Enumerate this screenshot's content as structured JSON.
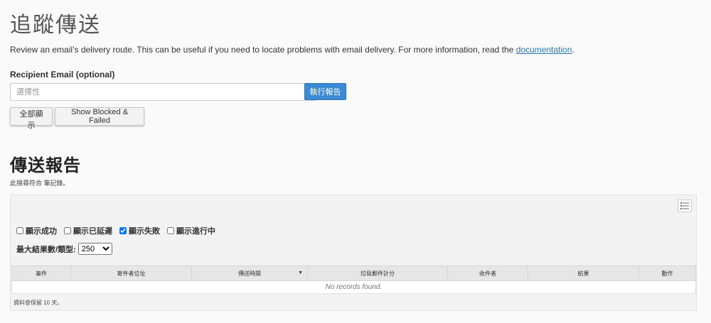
{
  "page": {
    "title": "追蹤傳送",
    "intro_text": "Review an email’s delivery route. This can be useful if you need to locate problems with email delivery. For more information, read the ",
    "intro_link": "documentation",
    "intro_end": "."
  },
  "form": {
    "recipient_label": "Recipient Email (optional)",
    "recipient_value": "",
    "recipient_placeholder": "選擇性",
    "run_button": "執行報告",
    "show_all_button": "全部顯示",
    "show_blocked_button": "Show Blocked & Failed"
  },
  "report": {
    "title": "傳送報告",
    "results_note": "此搜尋符合 筆記錄。",
    "filters": [
      {
        "label": "顯示成功",
        "checked": false
      },
      {
        "label": "顯示已延遲",
        "checked": false
      },
      {
        "label": "顯示失敗",
        "checked": true
      },
      {
        "label": "顯示進行中",
        "checked": false
      }
    ],
    "max_results_label": "最大結果數/類型:",
    "max_results_value": "250",
    "columns": [
      "事件",
      "寄件者位址",
      "傳送時間",
      "垃圾郵件計分",
      "收件者",
      "結果",
      "動作"
    ],
    "sorted_column_index": 2,
    "empty_text": "No records found.",
    "retention_note": "資料會保留 10 天。"
  },
  "icons": {
    "columns_toggle": "list-columns-icon",
    "sort": "sort-desc-icon"
  },
  "colors": {
    "primary_button": "#3d8ad4",
    "link": "#2a7ab0",
    "background": "#fafafa"
  }
}
